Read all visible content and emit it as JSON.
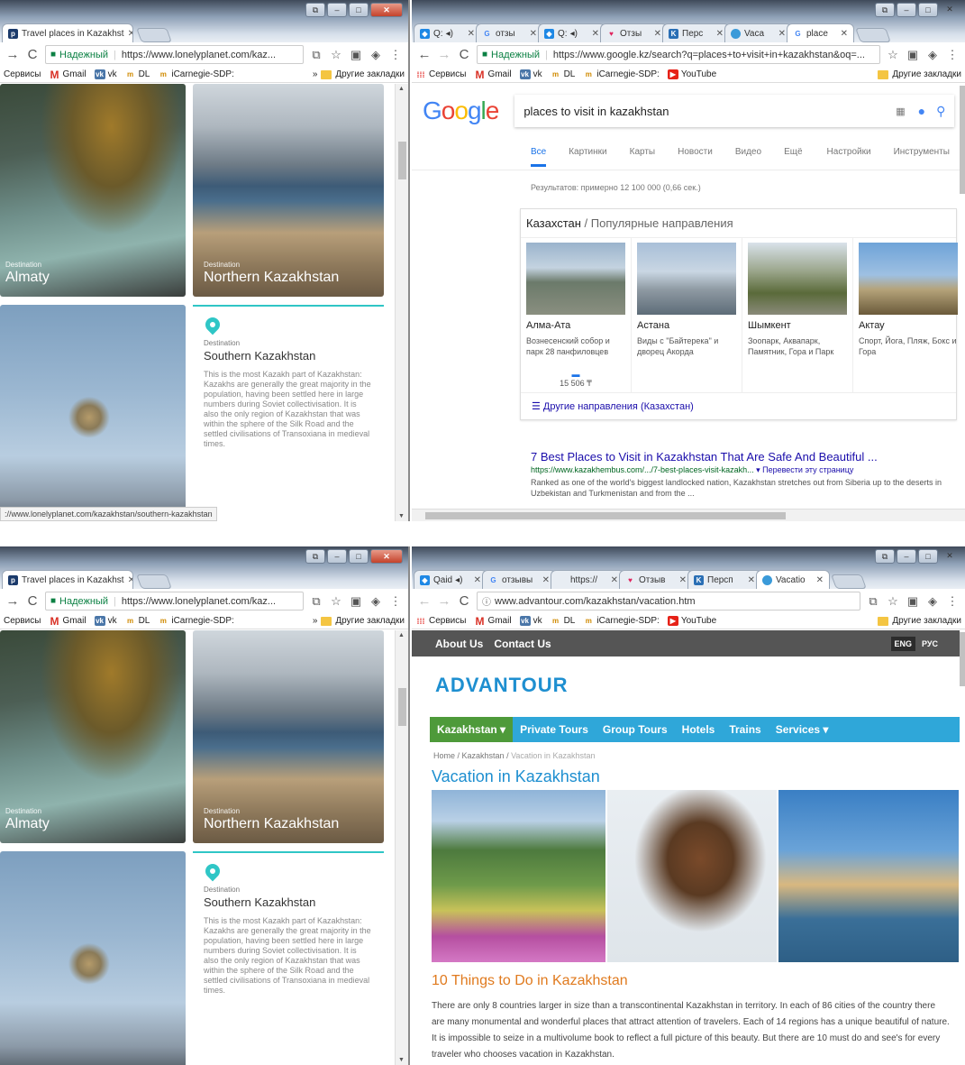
{
  "screen1": {
    "left": {
      "tabs": [
        {
          "label": "Travel places in Kazakhst",
          "active": true
        }
      ],
      "toolbar": {
        "secure": "Надежный",
        "url": "https://www.lonelyplanet.com/kaz..."
      },
      "bookmarks": [
        "Сервисы",
        "Gmail",
        "vk",
        "DL",
        "iCarnegie-SDP:"
      ],
      "bookmarks_more": "»",
      "other_bookmarks": "Другие закладки",
      "cards": {
        "almaty": {
          "kind": "Destination",
          "name": "Almaty"
        },
        "north": {
          "kind": "Destination",
          "name": "Northern Kazakhstan"
        },
        "south": {
          "kind": "Destination",
          "name": "Southern Kazakhstan",
          "desc": "This is the most Kazakh part of Kazakhstan: Kazakhs are generally the great majority in the population, having been settled here in large numbers during Soviet collectivisation. It is also the only region of Kazakhstan that was within the sphere of the Silk Road and the settled civilisations of Transoxiana in medieval times."
        }
      },
      "status": "://www.lonelyplanet.com/kazakhstan/southern-kazakhstan"
    },
    "right": {
      "tabs": [
        {
          "label": "Q:"
        },
        {
          "label": "отзы"
        },
        {
          "label": "Q:"
        },
        {
          "label": "Отзы"
        },
        {
          "label": "Перс"
        },
        {
          "label": "Vaca"
        },
        {
          "label": "place",
          "active": true
        }
      ],
      "toolbar": {
        "secure": "Надежный",
        "url": "https://www.google.kz/search?q=places+to+visit+in+kazakhstan&oq=..."
      },
      "bookmarks": [
        "Сервисы",
        "Gmail",
        "vk",
        "DL",
        "iCarnegie-SDP:",
        "YouTube"
      ],
      "other_bookmarks": "Другие закладки",
      "google": {
        "logo": "Google",
        "query": "places to visit in kazakhstan",
        "tabs": [
          "Все",
          "Картинки",
          "Карты",
          "Новости",
          "Видео",
          "Ещё",
          "Настройки",
          "Инструменты"
        ],
        "stats": "Результатов: примерно 12 100 000 (0,66 сек.)",
        "card_title": "Казахстан",
        "card_sub": " / Популярные направления",
        "places": [
          {
            "name": "Алма-Ата",
            "desc": "Вознесенский собор и парк 28 панфиловцев",
            "price": "15 506 ₸"
          },
          {
            "name": "Астана",
            "desc": "Виды с \"Байтерека\" и дворец Акорда",
            "price": ""
          },
          {
            "name": "Шымкент",
            "desc": "Зоопарк, Аквапарк, Памятник, Гора и Парк",
            "price": ""
          },
          {
            "name": "Актау",
            "desc": "Спорт, Йога, Пляж, Бокс и Гора",
            "price": ""
          }
        ],
        "more": "Другие направления (Казахстан)",
        "result": {
          "title": "7 Best Places to Visit in Kazakhstan That Are Safe And Beautiful ...",
          "url": "https://www.kazakhembus.com/.../7-best-places-visit-kazakh...",
          "translate": "▾ Перевести эту страницу",
          "snippet": "Ranked as one of the world's biggest landlocked nation, Kazakhstan stretches out from Siberia up to the deserts in Uzbekistan and Turkmenistan and from the ..."
        }
      }
    }
  },
  "screen2": {
    "left": {
      "tabs": [
        {
          "label": "Travel places in Kazakhst",
          "active": true
        }
      ],
      "toolbar": {
        "secure": "Надежный",
        "url": "https://www.lonelyplanet.com/kaz..."
      },
      "bookmarks": [
        "Сервисы",
        "Gmail",
        "vk",
        "DL",
        "iCarnegie-SDP:"
      ],
      "bookmarks_more": "»",
      "other_bookmarks": "Другие закладки"
    },
    "right": {
      "tabs": [
        {
          "label": "Qaid"
        },
        {
          "label": "отзывы"
        },
        {
          "label": "https://"
        },
        {
          "label": "Отзыв"
        },
        {
          "label": "Персп"
        },
        {
          "label": "Vacatio",
          "active": true
        }
      ],
      "toolbar": {
        "url": "www.advantour.com/kazakhstan/vacation.htm"
      },
      "bookmarks": [
        "Сервисы",
        "Gmail",
        "vk",
        "DL",
        "iCarnegie-SDP:",
        "YouTube"
      ],
      "other_bookmarks": "Другие закладки",
      "advantour": {
        "top_links": [
          "About Us",
          "Contact Us"
        ],
        "langs": [
          "ENG",
          "РУС"
        ],
        "logo": "ADVANTOUR",
        "menu": [
          "Kazakhstan ▾",
          "Private Tours",
          "Group Tours",
          "Hotels",
          "Trains",
          "Services ▾"
        ],
        "breadcrumb": [
          "Home",
          "Kazakhstan",
          "Vacation in Kazakhstan"
        ],
        "title": "Vacation in Kazakhstan",
        "subtitle": "10 Things to Do in Kazakhstan",
        "paragraph": "There are only 8 countries larger in size than a transcontinental Kazakhstan in territory. In each of 86 cities of the country there are many monumental and wonderful places that attract attention of travelers. Each of 14 regions has a unique beautiful of nature. It is impossible to seize in a multivolume book to reflect a full picture of this beauty. But there are 10 must do and see's for every traveler who chooses vacation in Kazakhstan."
      }
    }
  }
}
